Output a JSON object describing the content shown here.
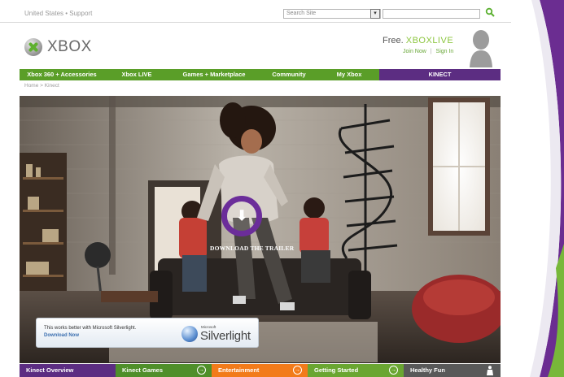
{
  "utility": {
    "locale": "United States  •  Support",
    "search_placeholder": "Search Site",
    "dropdown_glyph": "▾",
    "go_glyph": "Q"
  },
  "header": {
    "logo_text": "XBOX",
    "free_label": "Free.",
    "live_label": "XBOXLIVE",
    "join_label": "Join Now",
    "separator": "|",
    "signin_label": "Sign In"
  },
  "nav": {
    "items": [
      {
        "label": "Xbox 360 + Accessories"
      },
      {
        "label": "Xbox LIVE"
      },
      {
        "label": "Games + Marketplace"
      },
      {
        "label": "Community"
      },
      {
        "label": "My Xbox"
      },
      {
        "label": "KINECT"
      }
    ]
  },
  "breadcrumb": "Home > Kinect",
  "hero": {
    "trailer_label": "DOWNLOAD THE TRAILER",
    "arrow_glyph": "⬇"
  },
  "silverlight": {
    "message": "This works better with Microsoft Silverlight.",
    "link": "Download Now",
    "brand_small": "Microsoft",
    "brand": "Silverlight"
  },
  "bottom_tabs": [
    {
      "label": "Kinect Overview"
    },
    {
      "label": "Kinect Games"
    },
    {
      "label": "Entertainment"
    },
    {
      "label": "Getting Started"
    },
    {
      "label": "Healthy Fun"
    }
  ],
  "tab_arrow": "→",
  "colors": {
    "xbox_green": "#5a9e28",
    "kinect_purple": "#5c2d82",
    "orange": "#f27b1a"
  }
}
